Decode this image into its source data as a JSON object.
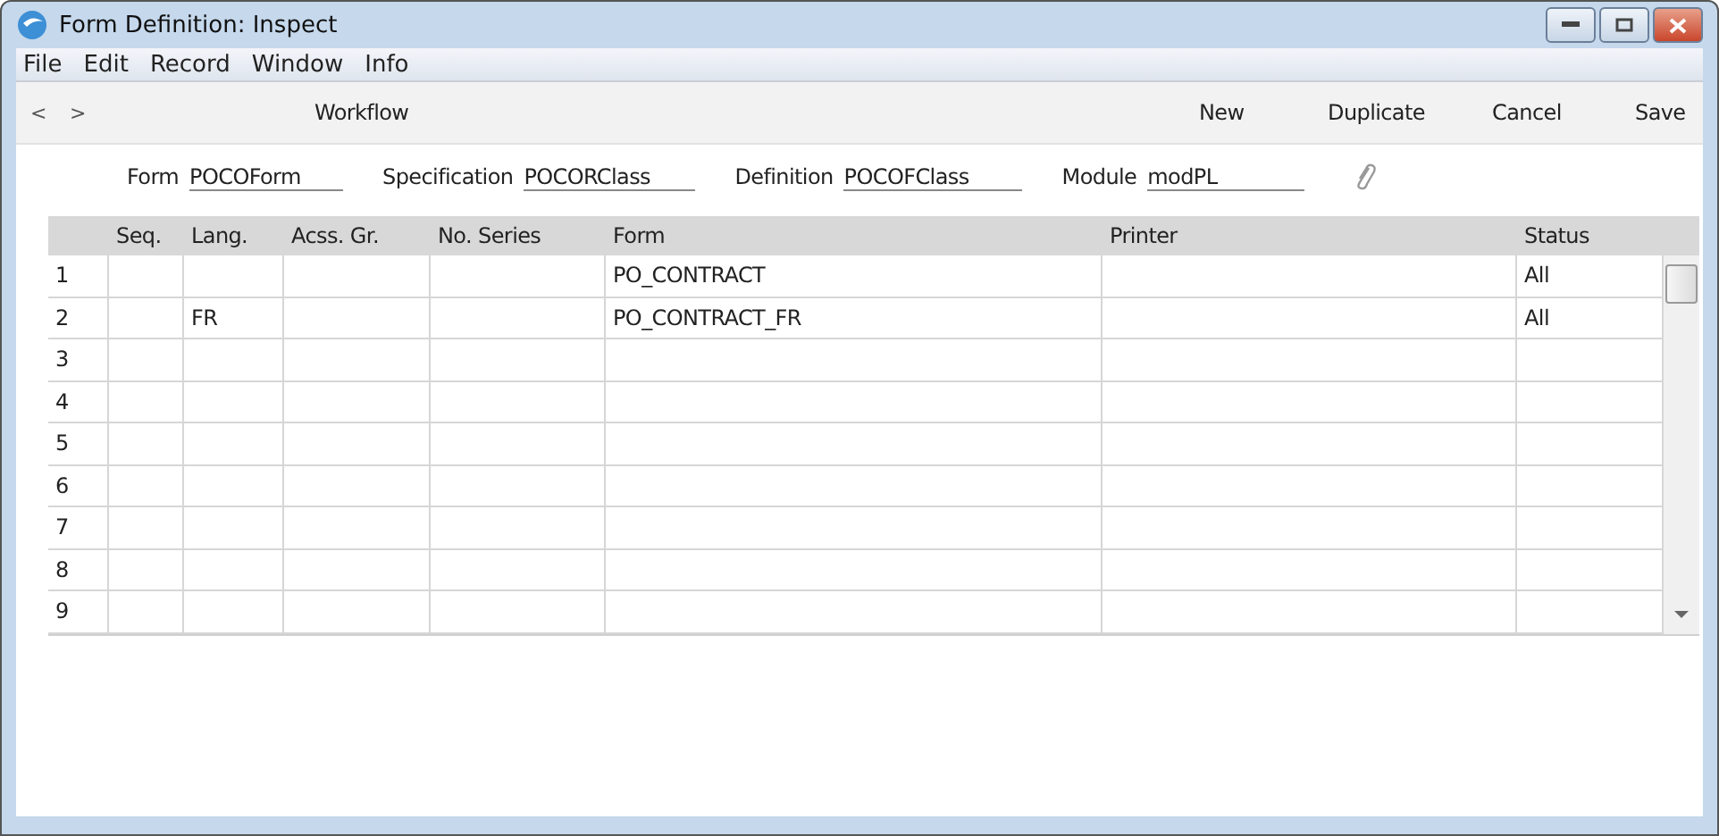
{
  "window": {
    "title": "Form Definition: Inspect"
  },
  "menu": [
    "File",
    "Edit",
    "Record",
    "Window",
    "Info"
  ],
  "toolbar": {
    "nav": [
      "<",
      ">"
    ],
    "workflow": "Workflow",
    "actions": [
      "New",
      "Duplicate",
      "Cancel",
      "Save"
    ]
  },
  "fields": [
    {
      "label": "Form",
      "value": "POCOForm"
    },
    {
      "label": "Specification",
      "value": "POCORClass"
    },
    {
      "label": "Definition",
      "value": "POCOFClass"
    },
    {
      "label": "Module",
      "value": "modPL"
    }
  ],
  "table": {
    "columns": [
      "Seq.",
      "Lang.",
      "Acss. Gr.",
      "No. Series",
      "Form",
      "Printer",
      "Status"
    ],
    "rows": [
      {
        "number": "1",
        "form": "PO_CONTRACT",
        "status": "All"
      },
      {
        "number": "2",
        "lang": "FR",
        "form": "PO_CONTRACT_FR",
        "status": "All"
      },
      {
        "number": "3"
      },
      {
        "number": "4"
      },
      {
        "number": "5"
      },
      {
        "number": "6"
      },
      {
        "number": "7"
      },
      {
        "number": "8"
      },
      {
        "number": "9"
      }
    ]
  }
}
